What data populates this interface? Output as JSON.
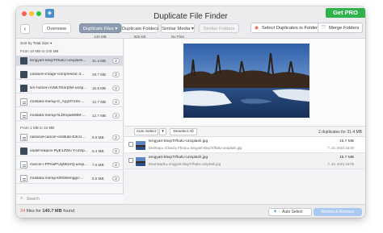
{
  "window": {
    "title": "Duplicate File Finder",
    "pro_label": "Get PRO",
    "app_icon": "app-icon"
  },
  "tabs": [
    {
      "label": "Duplicate Files ▾",
      "sub": "140 MB",
      "active": true
    },
    {
      "label": "Duplicate Folders",
      "sub": "825 KB",
      "active": false
    },
    {
      "label": "Similar Media ▾",
      "sub": "No Files",
      "active": false
    },
    {
      "label": "Similar Folders",
      "sub": "",
      "active": false
    }
  ],
  "toolbar": {
    "select_in_folder": "Select Duplicates in Folder",
    "merge_folders": "Merge Folders"
  },
  "sidebar": {
    "sort_label": "Sort by Total Size ▾",
    "group1": "From 10 MB to 100 MB",
    "group2": "From 1 MB to 10 MB",
    "files": [
      {
        "name": "tengyart-k5vpTrfhalU-unsplash...",
        "size": "31.4 MB",
        "count": "2",
        "icon": "image"
      },
      {
        "name": "cassium-image-compressor-3...",
        "size": "29.7 MB",
        "count": "2",
        "icon": "image"
      },
      {
        "name": "tim-hufner-nVMLTEerpWI-unsp...",
        "size": "16.8 MB",
        "count": "2",
        "icon": "image"
      },
      {
        "name": "mostafa-meraji-G_Apj1FmSk-...",
        "size": "12.7 MB",
        "count": "2",
        "icon": "doc"
      },
      {
        "name": "mostafa-meraji-hLDIrqiuleMM-...",
        "size": "12.7 MB",
        "count": "2",
        "icon": "doc"
      },
      {
        "name": "national-cancer-institute-E3cU...",
        "size": "9.6 MB",
        "count": "2",
        "icon": "doc"
      },
      {
        "name": "vadim-kaipov-RyE1ZWu Y-unsp...",
        "size": "8.4 MB",
        "count": "2",
        "icon": "image"
      },
      {
        "name": "marcel-i-PPewPUqNKerQ-unsp...",
        "size": "7.5 MB",
        "count": "2",
        "icon": "doc"
      },
      {
        "name": "mostafa-meraji-k0fSWenggo-...",
        "size": "6.5 MB",
        "count": "2",
        "icon": "doc"
      }
    ],
    "search_placeholder": "Search"
  },
  "controls": {
    "auto_select": "Auto Select",
    "auto_select_menu": "▾",
    "deselect_all": "Deselect All",
    "dup_info": "2 duplicates for 31.4 MB"
  },
  "duplicates": [
    {
      "name": "tengyart-k5vpTrfhalU-unsplash.jpg",
      "path": "Desktop ▸ iCloud ▸ Photo ▸ tengyart-k5vpTrfhalU-unsplash.jpg",
      "size": "15.7 MB",
      "date": "7. 10. 2021 15:00"
    },
    {
      "name": "tengyart-k5vpTrfhalU-unsplash.jpg",
      "path": "Downloads ▸ tengyart-k5vpTrfhalU-unsplash.jpg",
      "size": "15.7 MB",
      "date": "7. 10. 2021 15:05"
    }
  ],
  "footer": {
    "count": "34",
    "text_a": " files for ",
    "size": "140.7 MB",
    "text_b": " found",
    "auto_select": "Auto Select",
    "review_remove": "Review & Remove"
  }
}
